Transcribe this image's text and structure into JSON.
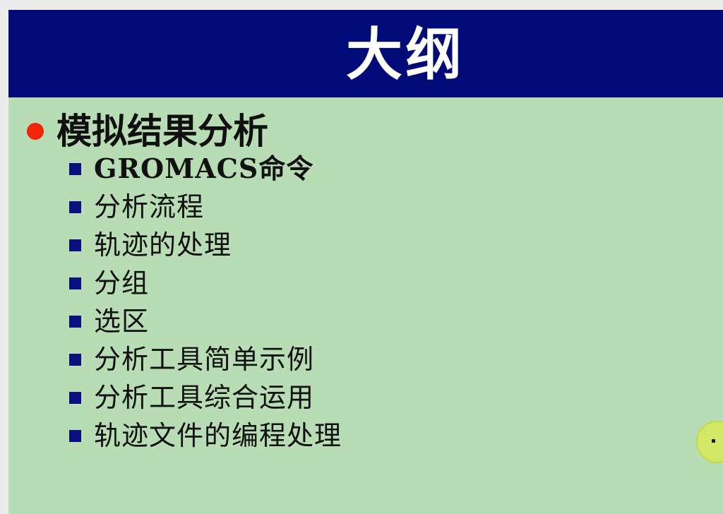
{
  "slide": {
    "title": "大纲",
    "main_bullet": "模拟结果分析",
    "sub_items": [
      {
        "label": "GROMACS命令"
      },
      {
        "label": "分析流程"
      },
      {
        "label": "轨迹的处理"
      },
      {
        "label": "分组"
      },
      {
        "label": "选区"
      },
      {
        "label": "分析工具简单示例"
      },
      {
        "label": "分析工具综合运用"
      },
      {
        "label": "轨迹文件的编程处理"
      }
    ]
  },
  "colors": {
    "title_bar": "#000b78",
    "slide_background": "#b8dcb4",
    "main_bullet_dot": "#f2240a",
    "sub_bullet_square": "#0a1080",
    "pointer_highlight": "#d4e868"
  },
  "icons": {
    "main_bullet": "red-dot-bullet-icon",
    "sub_bullet": "blue-square-bullet-icon",
    "pointer": "cursor-highlight-icon"
  }
}
